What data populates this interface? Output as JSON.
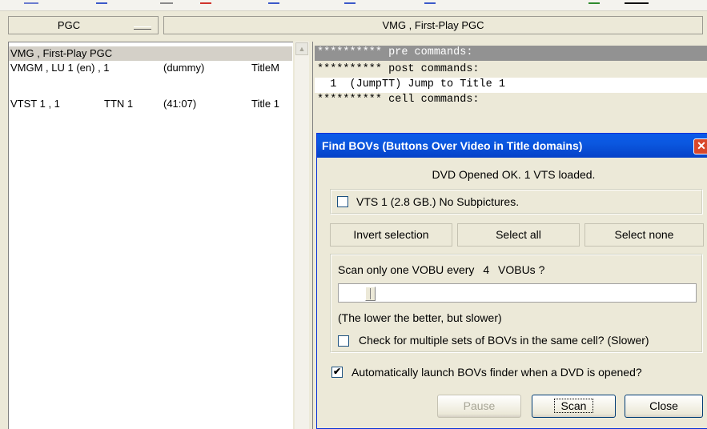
{
  "header": {
    "pgc_label": "PGC",
    "title": "VMG , First-Play PGC"
  },
  "pgc_list": [
    {
      "name": "VMG , First-Play PGC",
      "lu": "",
      "info": "",
      "title": "",
      "selected": true
    },
    {
      "name": "VMGM , LU 1 (en) , 1",
      "lu": "",
      "info": "(dummy)",
      "title": "TitleM",
      "selected": false
    },
    {
      "name": "VTST 1 , 1",
      "lu": "TTN 1",
      "info": "(41:07)",
      "title": "Title 1",
      "selected": false
    }
  ],
  "commands": [
    {
      "text": "********** pre commands:",
      "style": "hl"
    },
    {
      "text": "********** post commands:",
      "style": "normal"
    },
    {
      "text": "  1  (JumpTT) Jump to Title 1",
      "style": "white"
    },
    {
      "text": "********** cell commands:",
      "style": "normal"
    }
  ],
  "dialog": {
    "title": "Find BOVs (Buttons Over Video in Title domains)",
    "close_glyph": "✕",
    "status": "DVD Opened OK.  1 VTS loaded.",
    "vts_item": {
      "label": "VTS 1  (2.8 GB.)  No Subpictures.",
      "checked": false
    },
    "invert_label": "Invert selection",
    "select_all_label": "Select all",
    "select_none_label": "Select none",
    "scan_prefix": "Scan only one VOBU every",
    "scan_value": "4",
    "scan_suffix": "VOBUs ?",
    "lower_note": "(The lower the better, but slower)",
    "multi_label": "Check for multiple sets of BOVs in the same cell? (Slower)",
    "multi_checked": false,
    "auto_label": "Automatically launch BOVs finder when a DVD is opened?",
    "auto_checked": true,
    "check_glyph": "✔",
    "pause_label": "Pause",
    "scan_label": "Scan",
    "close_label": "Close"
  },
  "colors": {
    "titlebar": "#0a5ae8",
    "selection_gray": "#929292",
    "dialog_bg": "#ece9d8"
  }
}
